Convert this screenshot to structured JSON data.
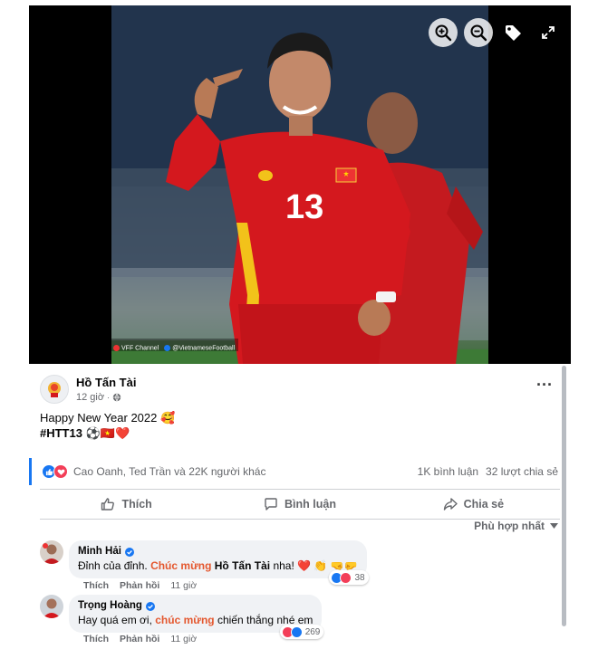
{
  "viewer": {
    "watermark_left": "VFF Channel",
    "watermark_right": "@VietnameseFootball",
    "jersey_number": "13",
    "buttons": [
      "zoom-in-icon",
      "zoom-out-icon",
      "tag-icon",
      "fullscreen-icon"
    ]
  },
  "post": {
    "author": "Hồ Tấn Tài",
    "time": "12 giờ",
    "text_line1": "Happy New Year 2022 🥰",
    "text_line2_tag": "#HTT13",
    "text_line2_emoji": " ⚽🇻🇳❤️",
    "reaction_names": "Cao Oanh, Ted Trần và 22K người khác",
    "comment_count": "1K bình luận",
    "share_count": "32 lượt chia sẻ",
    "actions": {
      "like": "Thích",
      "comment": "Bình luận",
      "share": "Chia sẻ"
    },
    "sort_label": "Phù hợp nhất"
  },
  "comments": [
    {
      "name": "Minh Hải",
      "text_pre": "Đỉnh của đỉnh. ",
      "text_hl": "Chúc mừng",
      "text_mid": " ",
      "text_mention": "Hồ Tấn Tài",
      "text_post": " nha! ❤️ 👏 🤜🤛",
      "reactions": "38",
      "like": "Thích",
      "reply": "Phản hồi",
      "time": "11 giờ"
    },
    {
      "name": "Trọng Hoàng",
      "text_pre": "Hay quá em ơi, ",
      "text_hl": "chúc mừng",
      "text_post": " chiến thắng nhé em",
      "reactions": "269",
      "like": "Thích",
      "reply": "Phản hồi",
      "time": "11 giờ"
    }
  ],
  "colors": {
    "accent": "#1877f2",
    "highlight": "#e4572e",
    "love": "#f33e58"
  }
}
